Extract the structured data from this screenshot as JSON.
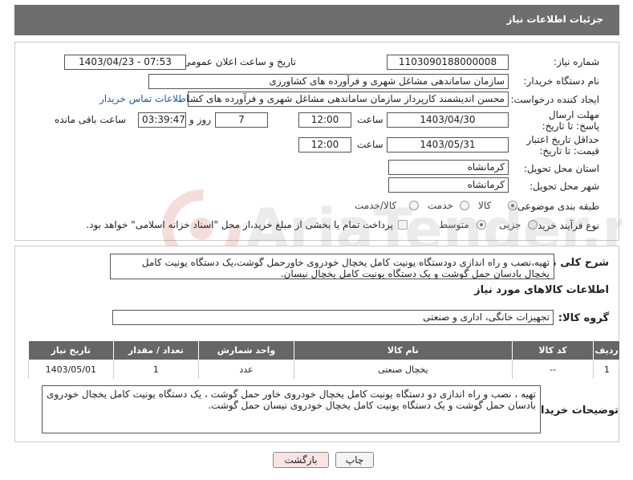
{
  "header": {
    "title": "جزئیات اطلاعات نیاز"
  },
  "form": {
    "need_number_label": "شماره نیاز:",
    "need_number": "1103090188000008",
    "announce_label": "تاریخ و ساعت اعلان عمومی:",
    "announce_value": "1403/04/23 - 07:53",
    "buyer_org_label": "نام دستگاه خریدار:",
    "buyer_org": "سازمان ساماندهی مشاغل شهری و فرآورده های کشاورزی",
    "requester_label": "ایجاد کننده درخواست:",
    "requester": "محسن اندیشمند کارپرداز سازمان ساماندهی مشاغل شهری و فرآورده های کشا",
    "contact_link": "اطلاعات تماس خریدار",
    "reply_deadline_label": "مهلت ارسال پاسخ: تا تاریخ:",
    "reply_date": "1403/04/30",
    "time_label": "ساعت",
    "reply_time": "12:00",
    "days_value": "7",
    "days_label": "روز و",
    "remaining_time": "03:39:47",
    "remaining_label": "ساعت باقی مانده",
    "price_validity_label": "حداقل تاریخ اعتبار قیمت: تا تاریخ:",
    "price_validity_date": "1403/05/31",
    "price_validity_time": "12:00",
    "province_label": "استان محل تحویل:",
    "province": "کرمانشاه",
    "city_label": "شهر محل تحویل:",
    "city": "کرمانشاه",
    "category_label": "طبقه بندی موضوعی:",
    "category_options": [
      "کالا",
      "خدمت",
      "کالا/خدمت"
    ],
    "process_label": "نوع فرآیند خرید :",
    "process_options": [
      "جزیی",
      "متوسط"
    ],
    "payment_note": "پرداخت تمام یا بخشی از مبلغ خرید،از محل \"اسناد خزانه اسلامی\" خواهد بود."
  },
  "details": {
    "general_desc_label": "شرح کلی نیاز:",
    "general_desc": "تهیه،نصب و راه اندازی دودستگاه یونیت کامل یخچال خودروی خاورحمل گوشت،یک دستگاه یونیت کامل یخچال بادسان حمل گوشت و یک دستگاه یونیت کامل یخچال نیسان.",
    "goods_info_title": "اطلاعات کالاهای مورد نیاز",
    "goods_group_label": "گروه کالا:",
    "goods_group": "تجهیزات خانگی، اداری و صنعتی",
    "table_headers": [
      "ردیف",
      "کد کالا",
      "نام کالا",
      "واحد شمارش",
      "تعداد / مقدار",
      "تاریخ نیاز"
    ],
    "table_rows": [
      [
        "1",
        "--",
        "یخچال صنعتی",
        "عدد",
        "1",
        "1403/05/01"
      ]
    ],
    "buyer_notes_label": "توضیحات خریدار:",
    "buyer_notes": "تهیه ، نصب و راه اندازی دو دستگاه یونیت کامل یخچال خودروی خاور حمل گوشت ، یک دستگاه یونیت کامل یخچال خودروی بادسان حمل گوشت و یک دستگاه یونیت کامل یخچال خودروی نیسان حمل گوشت."
  },
  "buttons": {
    "print": "چاپ",
    "back": "بازگشت"
  },
  "colors": {
    "header_bg": "#6e6e6e",
    "table_header_bg": "#666666",
    "link": "#1a5aa6",
    "back_button_bg": "#fbe3e3"
  },
  "watermark": "AriaTender.neT"
}
